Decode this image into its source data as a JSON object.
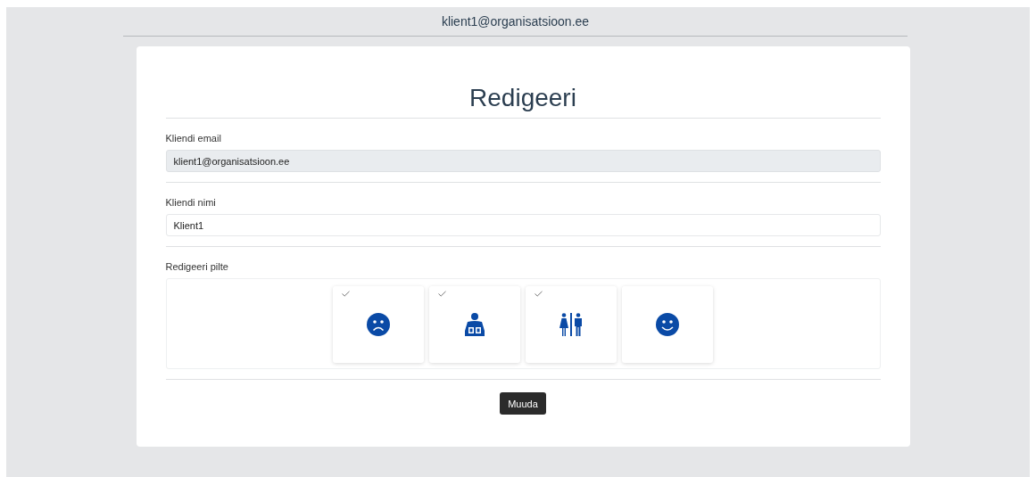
{
  "header": {
    "user_email": "klient1@organisatsioon.ee"
  },
  "form": {
    "title": "Redigeeri",
    "email_field": {
      "label": "Kliendi email",
      "value": "klient1@organisatsioon.ee",
      "disabled": true
    },
    "name_field": {
      "label": "Kliendi nimi",
      "value": "Klient1",
      "disabled": false
    },
    "pictures": {
      "label": "Redigeeri pilte",
      "items": [
        {
          "kind": "sad",
          "checked": true
        },
        {
          "kind": "reader",
          "checked": true
        },
        {
          "kind": "restroom",
          "checked": true
        },
        {
          "kind": "smile",
          "checked": false
        }
      ]
    },
    "submit_button": "Muuda"
  }
}
